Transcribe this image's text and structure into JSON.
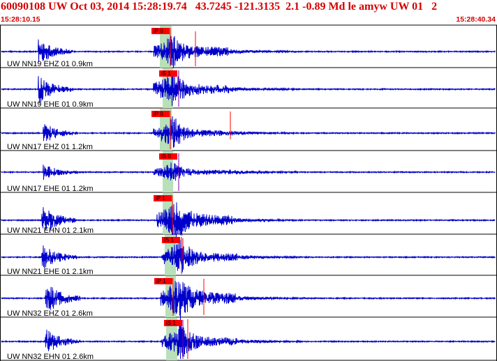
{
  "header": {
    "title": "60090108 UW Oct 03, 2014 15:28:19.74   43.7245 -121.3135  2.1 -0.89 Md le amyw UW 01   2",
    "start_time": "15:28:10.15",
    "end_time": "15:28:40.34"
  },
  "colors": {
    "text_red": "#d50000",
    "trace": "#0000cc",
    "pick_tag": "#ff0000",
    "pick_line_p": "#ff0000",
    "pick_line_s": "#7700aa",
    "highlight": "#b9e0b9",
    "separator": "#000000"
  },
  "channels": [
    {
      "label": "UW NN19 EHZ 01 0.9km",
      "pick": "iP 0",
      "pick_type": "P"
    },
    {
      "label": "UW NN19 EHE 01 0.9km",
      "pick": "iS 1",
      "pick_type": "S"
    },
    {
      "label": "UW NN17 EHZ 01 1.2km",
      "pick": "iP 0",
      "pick_type": "P"
    },
    {
      "label": "UW NN17 EHE 01 1.2km",
      "pick": "iS 0",
      "pick_type": "S"
    },
    {
      "label": "UW NN21 EHN 01 2.1km",
      "pick": "iP 1",
      "pick_type": "P"
    },
    {
      "label": "UW NN21 EHE 01 2.1km",
      "pick": "iS 1",
      "pick_type": "S"
    },
    {
      "label": "UW NN32 EHZ 01 2.6km",
      "pick": "iP 1",
      "pick_type": "P"
    },
    {
      "label": "UW NN32 EHN 01 2.6km",
      "pick": "iS 1",
      "pick_type": "S"
    }
  ]
}
